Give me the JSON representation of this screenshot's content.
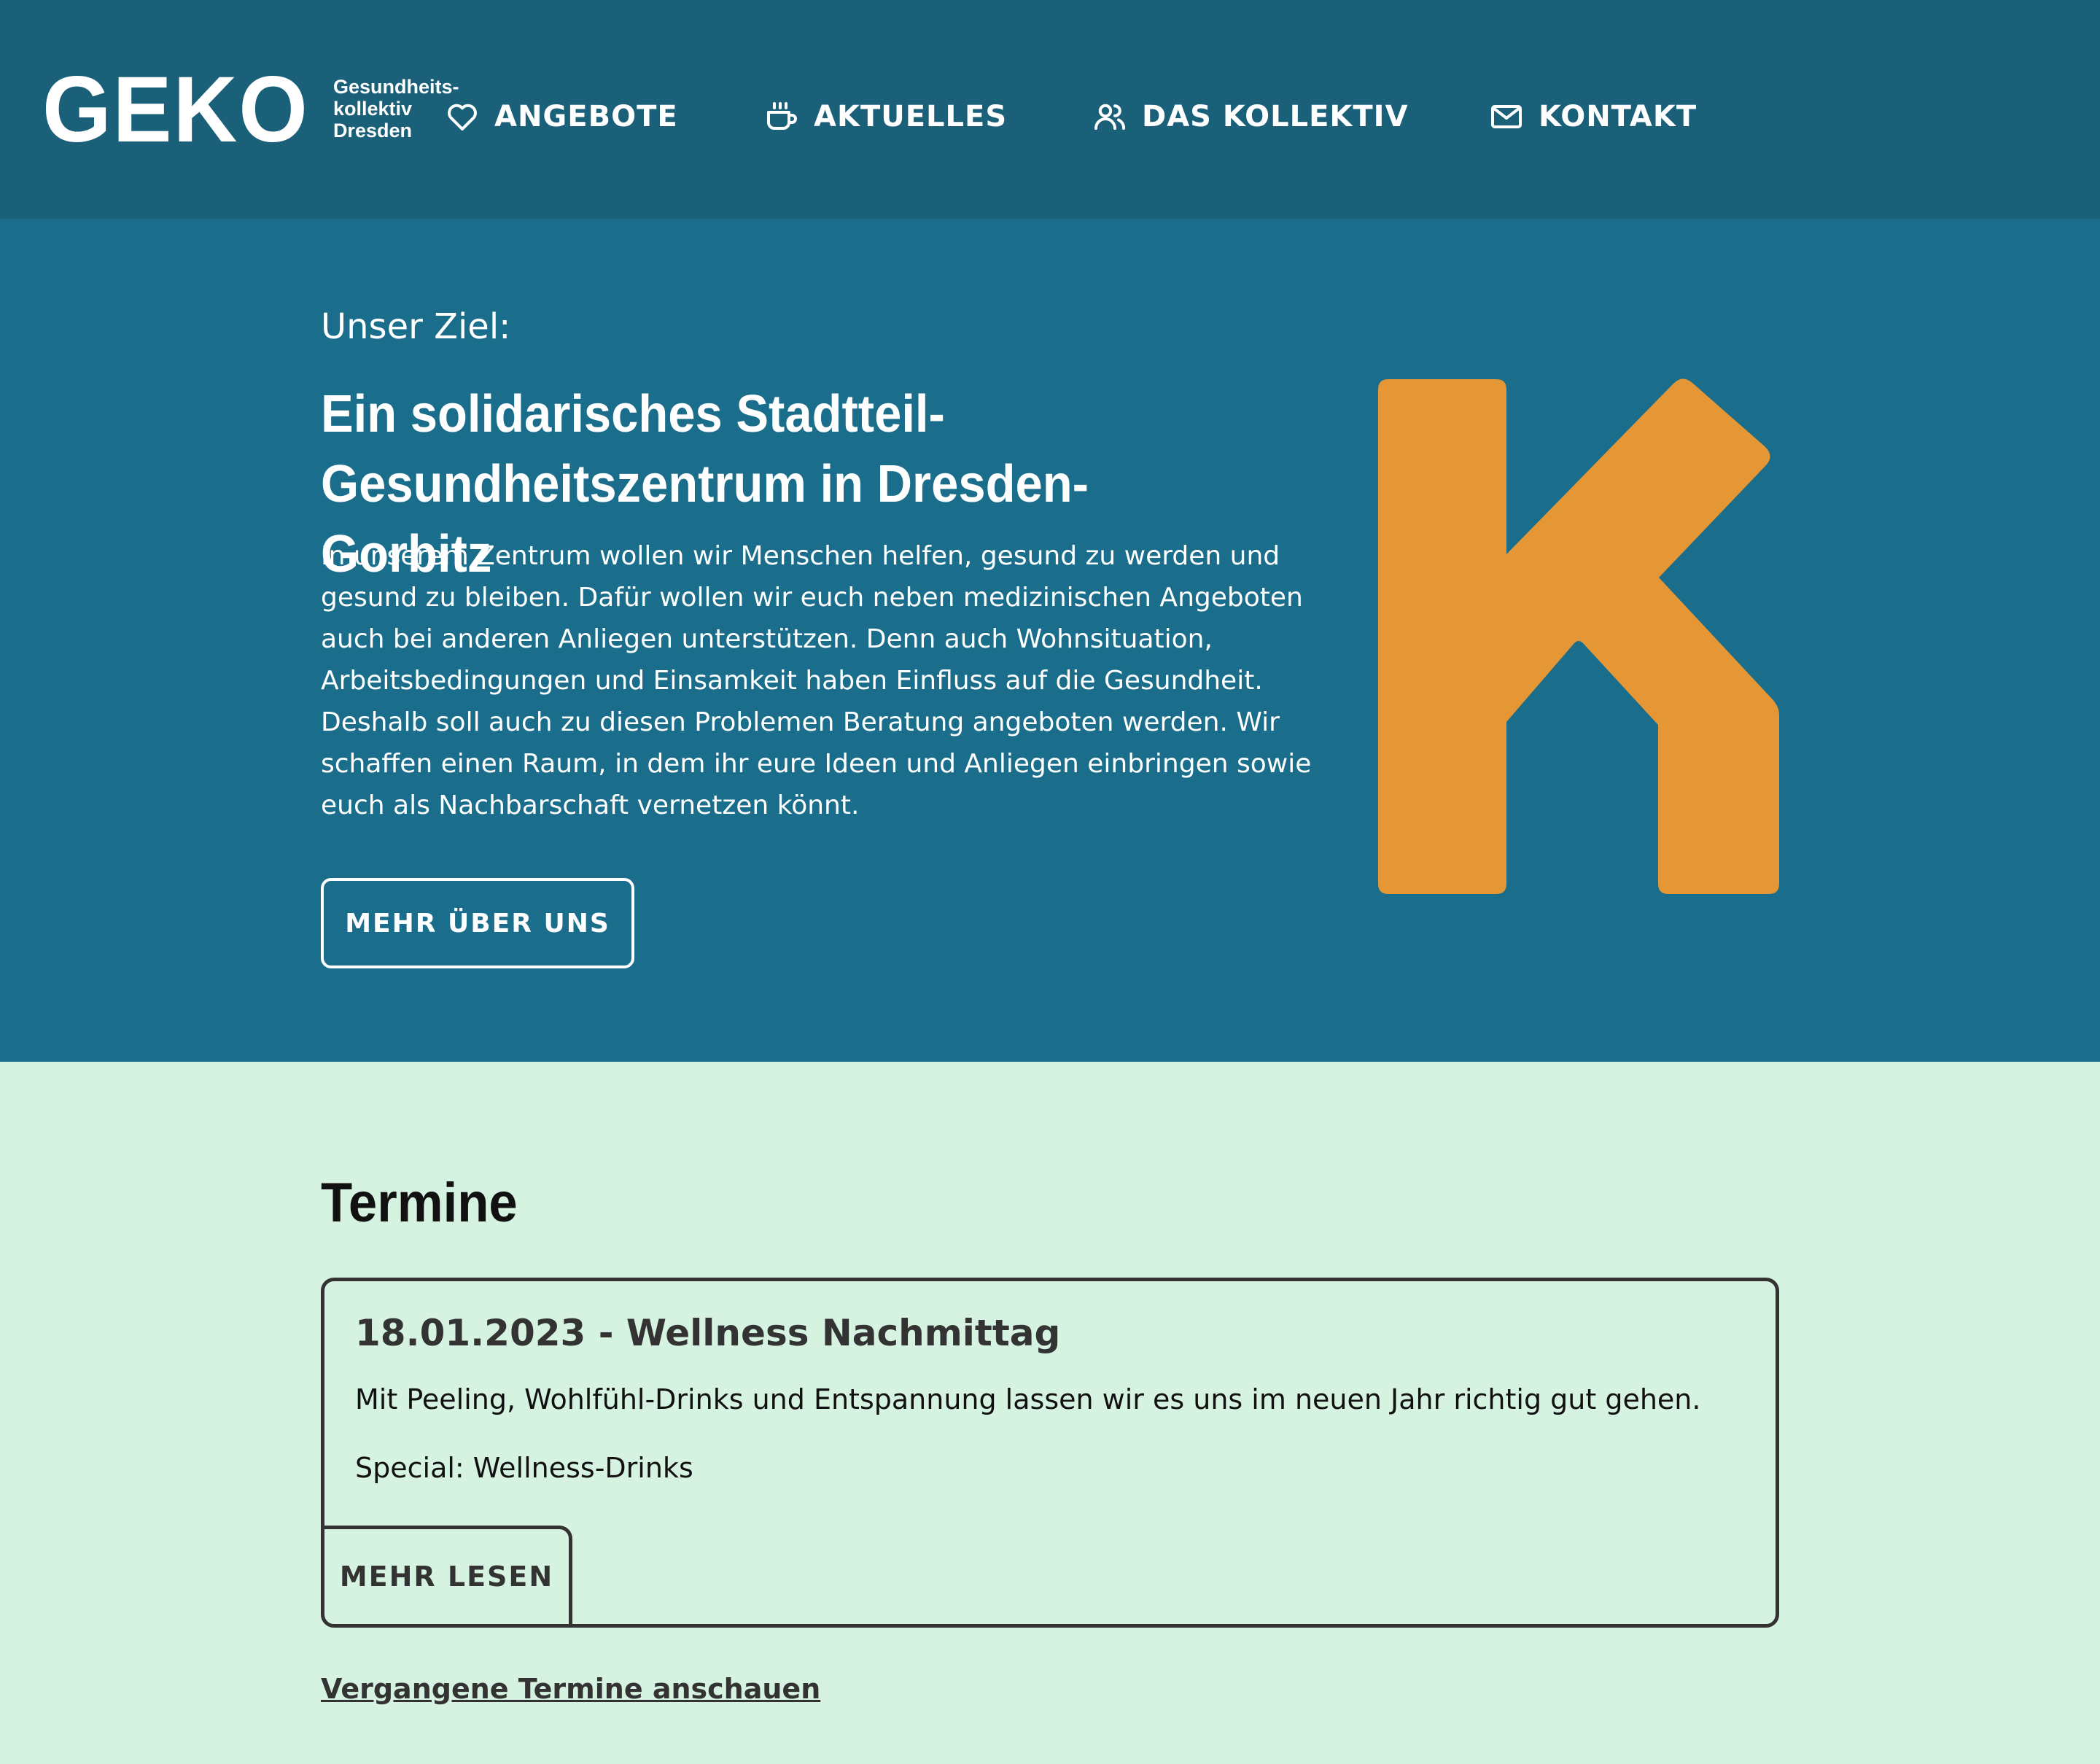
{
  "header": {
    "logo": {
      "word": "GEKO",
      "sub_line1": "Gesundheits-",
      "sub_line2": "kollektiv",
      "sub_line3": "Dresden"
    },
    "nav": [
      {
        "label": "ANGEBOTE",
        "icon": "heart-icon"
      },
      {
        "label": "AKTUELLES",
        "icon": "cup-icon"
      },
      {
        "label": "DAS KOLLEKTIV",
        "icon": "users-icon"
      },
      {
        "label": "KONTAKT",
        "icon": "mail-icon"
      }
    ]
  },
  "hero": {
    "kicker": "Unser Ziel:",
    "title_line1": "Ein solidarisches Stadtteil-",
    "title_line2": "Gesundheitszentrum in Dresden-Gorbitz",
    "text": "In unserem Zentrum wollen wir Menschen helfen, gesund zu werden und gesund zu bleiben. Dafür wollen wir euch neben medizinischen Angeboten auch bei anderen Anliegen unterstützen. Denn auch Wohnsituation, Arbeitsbedingungen und Einsamkeit haben Einfluss auf die Gesundheit. Deshalb soll auch zu diesen Problemen Beratung angeboten werden. Wir schaffen einen Raum, in dem ihr eure Ideen und Anliegen einbringen sowie euch als Nachbarschaft vernetzen könnt.",
    "button_label": "MEHR ÜBER UNS",
    "k_color": "#e59736"
  },
  "events": {
    "title": "Termine",
    "items": [
      {
        "title": "18.01.2023 - Wellness Nachmittag",
        "description": "Mit Peeling, Wohlfühl-Drinks und Entspannung lassen wir es uns im neuen Jahr richtig gut gehen.",
        "special": "Special: Wellness-Drinks",
        "more_label": "MEHR LESEN"
      }
    ],
    "past_link": "Vergangene Termine anschauen"
  },
  "colors": {
    "header_bg": "#1a6078",
    "hero_bg": "#1a6d8b",
    "events_bg": "#d6f2e0",
    "accent_orange": "#e59736"
  }
}
